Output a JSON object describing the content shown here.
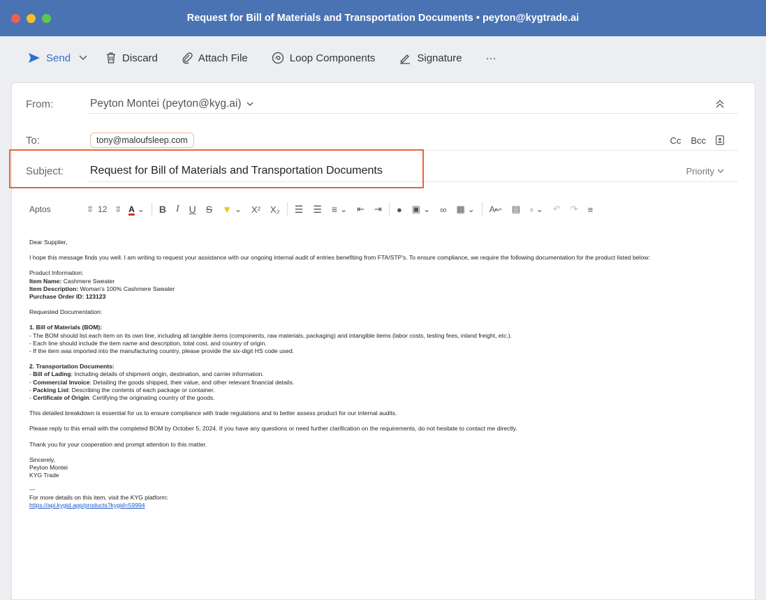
{
  "window": {
    "title": "Request for Bill of Materials and Transportation Documents • peyton@kygtrade.ai"
  },
  "toolbar": {
    "send": "Send",
    "discard": "Discard",
    "attach": "Attach File",
    "loop": "Loop Components",
    "signature": "Signature",
    "more": "···"
  },
  "header": {
    "from_label": "From:",
    "from_value": "Peyton Montei (peyton@kyg.ai)",
    "to_label": "To:",
    "to_value": "tony@maloufsleep.com",
    "cc": "Cc",
    "bcc": "Bcc",
    "subject_label": "Subject:",
    "subject_value": "Request for Bill of Materials and Transportation Documents",
    "priority": "Priority"
  },
  "format": {
    "font": "Aptos",
    "size": "12"
  },
  "body": {
    "greeting": "Dear Supplier,",
    "intro": "I hope this message finds you well. I am writing to request your assistance with our ongoing internal audit of entries benefiting from FTA/STP's. To ensure compliance, we require the following documentation for the product listed below:",
    "product_info": "Product Information:",
    "item_name_label": "Item Name:",
    "item_name": " Cashmere Sweater",
    "item_desc_label": "Item Description:",
    "item_desc": " Woman's 100% Cashmere Sweater",
    "po_label": "Purchase Order ID: 123123",
    "requested": "Requested Documentation:",
    "bom_head": "1. Bill of Materials (BOM):",
    "bom_1": "- The BOM should list each item on its own line, including all tangible items (components, raw materials, packaging) and intangible items (labor costs, testing fees, inland freight, etc.).",
    "bom_2": "- Each line should include the item name and description, total cost, and country of origin.",
    "bom_3": "- If the item was imported into the manufacturing country, please provide the six-digit HS code used.",
    "td_head": "2. Transportation Documents:",
    "td_1_label": "Bill of Lading",
    "td_1": ": Including details of shipment origin, destination, and carrier information.",
    "td_2_label": "Commercial Invoice",
    "td_2": ": Detailing the goods shipped, their value, and other relevant financial details.",
    "td_3_label": "Packing List",
    "td_3": ": Describing the contents of each package or container.",
    "td_4_label": "Certificate of Origin",
    "td_4": ": Certifying the originating country of the goods.",
    "para_breakdown": "This detailed breakdown is essential for us to ensure compliance with trade regulations and to better assess product for our internal audits.",
    "para_reply": "Please reply to this email with the completed BOM by October 5, 2024. If you have any questions or need further clarification on the requirements, do not hesitate to contact me directly.",
    "para_thanks": "Thank you for your cooperation and prompt attention to this matter.",
    "sign_1": "Sincerely,",
    "sign_2": "Peyton Montei",
    "sign_3": "KYG Trade",
    "dash": "---",
    "more_details": "For more details on this item, visit the KYG platform:",
    "link": "https://api.kygid.app/products?kygid=59994"
  }
}
